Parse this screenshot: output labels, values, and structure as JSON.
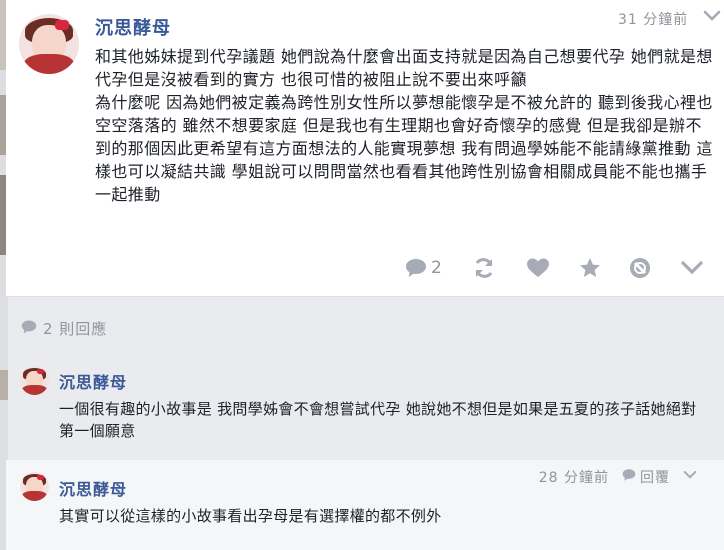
{
  "post": {
    "author": "沉思酵母",
    "time": "31 分鐘前",
    "paragraphs": [
      "和其他姊妹提到代孕議題 她們說為什麼會出面支持就是因為自己想要代孕 她們就是想代孕但是沒被看到的實方 也很可惜的被阻止說不要出來呼籲",
      "為什麼呢 因為她們被定義為跨性別女性所以夢想能懷孕是不被允許的 聽到後我心裡也空空落落的 雖然不想要家庭 但是我也有生理期也會好奇懷孕的感覺 但是我卻是辦不到的那個因此更希望有這方面想法的人能實現夢想 我有問過學姊能不能請綠黨推動 這樣也可以凝結共識 學姐說可以問問當然也看看其他跨性別協會相關成員能不能也攜手一起推動"
    ],
    "comment_count": "2",
    "icons": [
      "comment-icon",
      "share-icon",
      "heart-icon",
      "star-icon",
      "mute-icon",
      "chevron-down-icon"
    ]
  },
  "replies_header": {
    "label": "2 則回應",
    "icon": "comment-icon"
  },
  "replies": [
    {
      "author": "沉思酵母",
      "text": "一個很有趣的小故事是 我問學姊會不會想嘗試代孕 她說她不想但是如果是五夏的孩子話她絕對第一個願意"
    },
    {
      "author": "沉思酵母",
      "text": "其實可以從這樣的小故事看出孕母是有選擇權的都不例外",
      "time": "28 分鐘前",
      "reply_label": "回覆"
    }
  ],
  "colors": {
    "link": "#3b5998",
    "muted": "#90949c",
    "icon": "#a6abb5",
    "background": "#e9ebee"
  }
}
